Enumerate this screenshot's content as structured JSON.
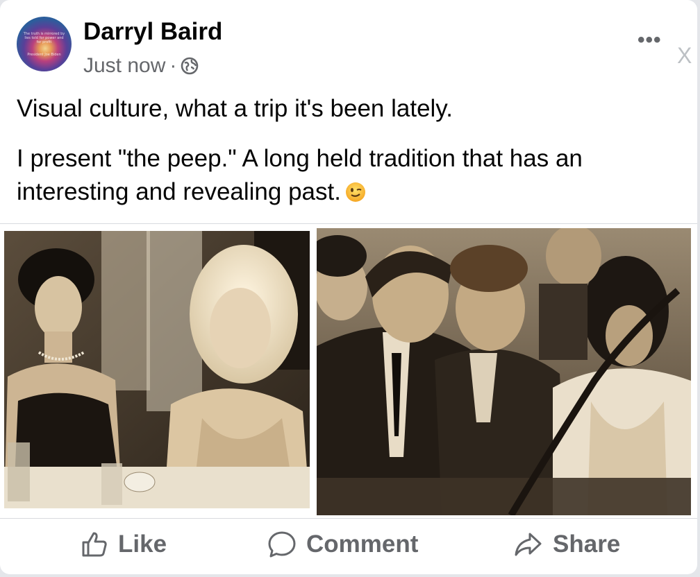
{
  "post": {
    "author": "Darryl Baird",
    "timestamp": "Just now",
    "separator": "·",
    "privacy_icon": "globe-icon",
    "more_label": "•••",
    "close_label": "X",
    "avatar_text": "The truth is mirrored by lies told for power and for profit",
    "avatar_subtext": "President Joe Biden",
    "text_line1": "Visual culture, what a trip it's been lately.",
    "text_para2": "I present \"the peep.\" A long held tradition that has an interesting and revealing past.",
    "emoji": "winking-face-icon"
  },
  "media": {
    "images": [
      {
        "name": "photo-left",
        "tone": "sepia"
      },
      {
        "name": "photo-right",
        "tone": "sepia"
      }
    ]
  },
  "actions": {
    "like_label": "Like",
    "comment_label": "Comment",
    "share_label": "Share"
  },
  "colors": {
    "text_primary": "#050505",
    "text_secondary": "#65676b",
    "background": "#ffffff",
    "divider": "#d8dadf"
  }
}
